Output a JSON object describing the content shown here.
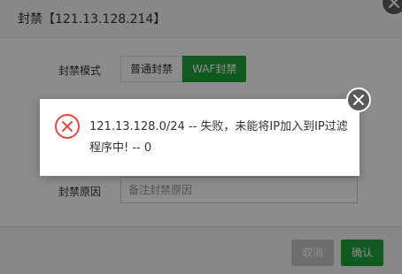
{
  "dialog": {
    "title": "封禁【121.13.128.214】",
    "mode_label": "封禁模式",
    "modes": [
      "普通封禁",
      "WAF封禁"
    ],
    "selected_mode": "WAF封禁",
    "remark_label": "封禁原因",
    "remark_placeholder": "备注封禁原因",
    "cancel_label": "取消",
    "confirm_label": "确认"
  },
  "message": {
    "text": "121.13.128.0/24 -- 失败，未能将IP加入到IP过滤程序中! -- 0",
    "icon": "error-circle-icon"
  },
  "colors": {
    "accent": "#20a53a",
    "error": "#e64646"
  }
}
